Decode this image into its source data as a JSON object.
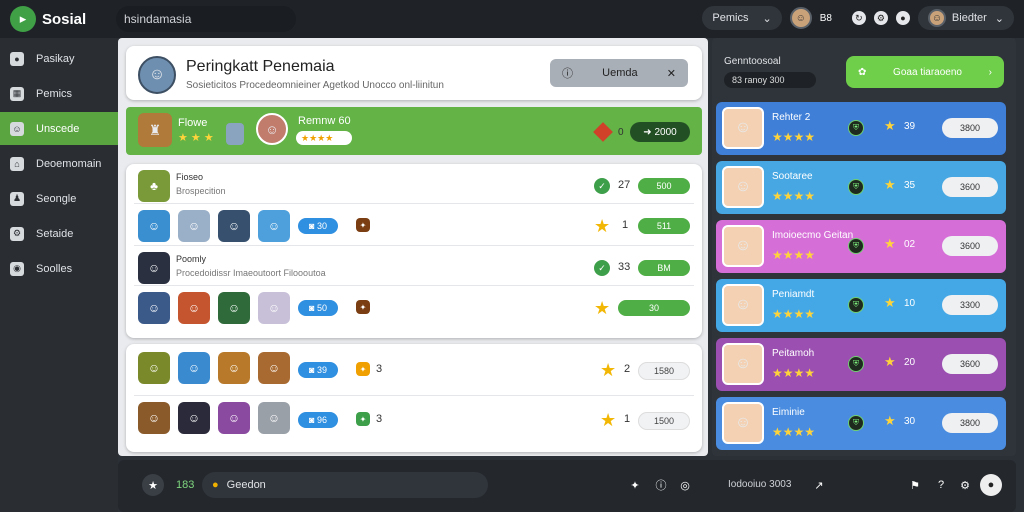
{
  "topbar": {
    "app_title": "Sosial",
    "search_text": "hsindamasia",
    "filter_label": "Pemics",
    "avatar_count": "B8",
    "user_name": "Biedter"
  },
  "sidebar": {
    "items": [
      {
        "label": "Pasikay",
        "icon": "user-icon"
      },
      {
        "label": "Pemics",
        "icon": "grid-icon"
      },
      {
        "label": "Unscede",
        "icon": "avatar-icon"
      },
      {
        "label": "Deoemomain",
        "icon": "home-icon"
      },
      {
        "label": "Seongle",
        "icon": "person-icon"
      },
      {
        "label": "Setaide",
        "icon": "settings-icon"
      },
      {
        "label": "Soolles",
        "icon": "eye-icon"
      }
    ],
    "active_index": 2
  },
  "header": {
    "title": "Peringkatt Penemaia",
    "subtitle": "Sosieticitos Procedeomnieiner Agetkod Unocco onl-liinitun",
    "button_label": "Uemda",
    "accent": "#63b347"
  },
  "highlight": {
    "name": "Flowe",
    "stars": "★ ★ ★",
    "name2": "Remnw 60",
    "pill": "★★★★",
    "dot": "0",
    "button": "2000"
  },
  "list1": [
    {
      "type": "title",
      "name": "Fioseo",
      "sub": "Brospecition",
      "score": "27",
      "btn": "500"
    },
    {
      "type": "icons",
      "badge": "30",
      "num": "1",
      "btn": "511"
    },
    {
      "type": "title",
      "name": "Poomly",
      "sub": "Procedoidissr Imaeoutoort Filoooutoa",
      "score": "33",
      "btn": "BM"
    },
    {
      "type": "icons",
      "badge": "50",
      "num": "",
      "btn": "30"
    }
  ],
  "list2": [
    {
      "badge": "39",
      "small": "3",
      "num": "2",
      "btn": "1580"
    },
    {
      "badge": "96",
      "small": "3",
      "num": "1",
      "btn": "1500"
    }
  ],
  "leaderboard": {
    "title": "Genntoosoal",
    "subtitle": "83 ranoy 300",
    "button_label": "Goaa tiaraoeno",
    "entries": [
      {
        "name": "Rehter 2",
        "stars": "★★★★",
        "num": "39",
        "btn": "3800",
        "color": "#3f7fd7"
      },
      {
        "name": "Sootaree",
        "stars": "★★★★",
        "num": "35",
        "btn": "3600",
        "color": "#47a7e2"
      },
      {
        "name": "Imoioecmo Geitan",
        "stars": "★★★★",
        "num": "02",
        "btn": "3600",
        "color": "#d56fd7"
      },
      {
        "name": "Peniamdt",
        "stars": "★★★★",
        "num": "10",
        "btn": "3300",
        "color": "#45a8e6"
      },
      {
        "name": "Peitamoh",
        "stars": "★★★★",
        "num": "20",
        "btn": "3600",
        "color": "#9a4fb1"
      },
      {
        "name": "Eiminie",
        "stars": "★★★★",
        "num": "30",
        "btn": "3800",
        "color": "#4a8de0"
      }
    ]
  },
  "bottombar": {
    "count": "183",
    "input_label": "Geedon",
    "status": "Iodooiuo 3003"
  }
}
